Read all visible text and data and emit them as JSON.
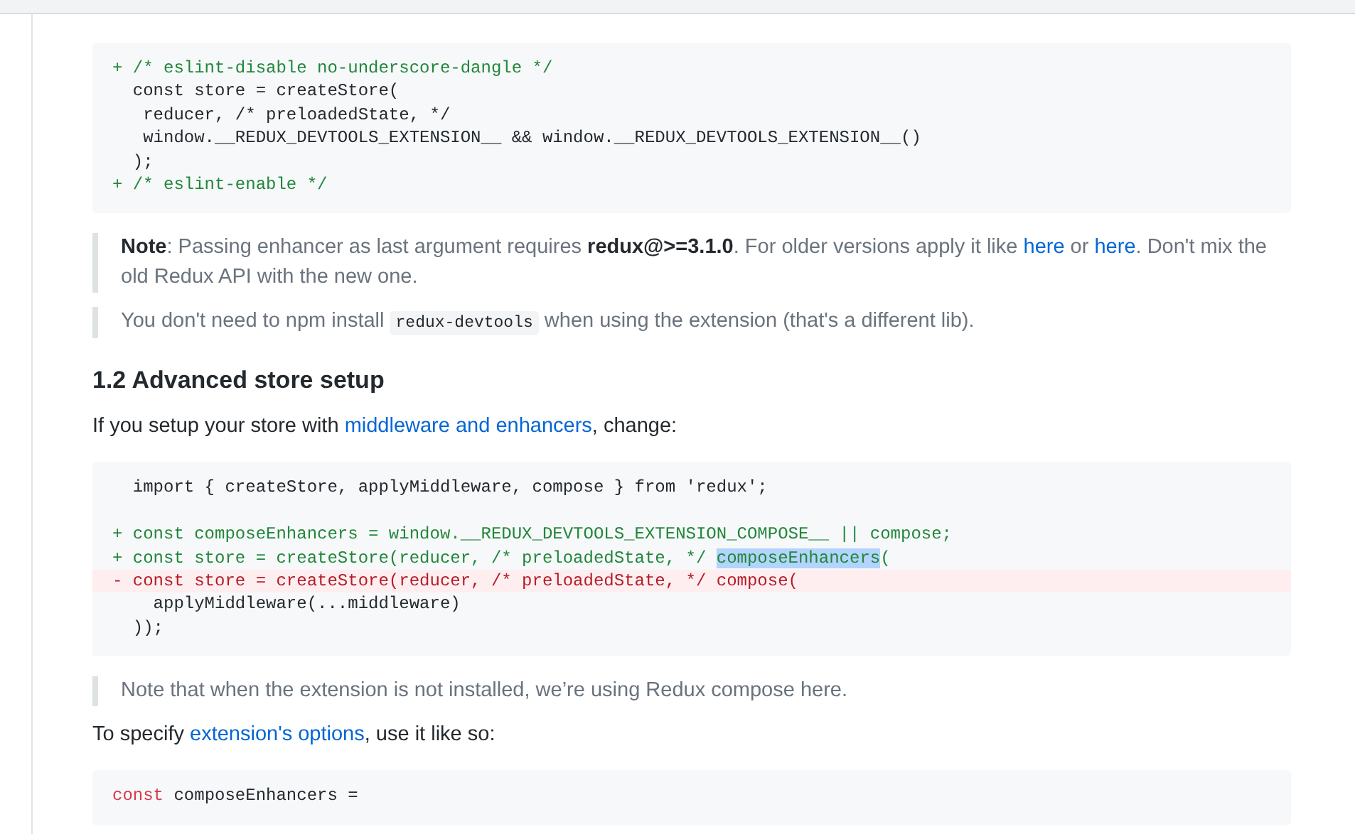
{
  "blocks": [
    {
      "kind": "code",
      "lines": [
        {
          "kind": "add",
          "parts": [
            {
              "text": "+ /* eslint-disable no-underscore-dangle */",
              "selected": false
            }
          ]
        },
        {
          "kind": "plain",
          "parts": [
            {
              "text": "  const store = createStore(",
              "selected": false
            }
          ]
        },
        {
          "kind": "plain",
          "parts": [
            {
              "text": "   reducer, /* preloadedState, */",
              "selected": false
            }
          ]
        },
        {
          "kind": "plain",
          "parts": [
            {
              "text": "   window.__REDUX_DEVTOOLS_EXTENSION__ && window.__REDUX_DEVTOOLS_EXTENSION__()",
              "selected": false
            }
          ]
        },
        {
          "kind": "plain",
          "parts": [
            {
              "text": "  );",
              "selected": false
            }
          ]
        },
        {
          "kind": "add",
          "parts": [
            {
              "text": "+ /* eslint-enable */",
              "selected": false
            }
          ]
        }
      ]
    },
    {
      "kind": "quote",
      "parts": [
        {
          "kind": "bold",
          "text": "Note"
        },
        {
          "kind": "plain",
          "text": ": Passing enhancer as last argument requires "
        },
        {
          "kind": "bold",
          "text": "redux@>=3.1.0"
        },
        {
          "kind": "plain",
          "text": ". For older versions apply it like "
        },
        {
          "kind": "link",
          "text": "here"
        },
        {
          "kind": "plain",
          "text": " or "
        },
        {
          "kind": "link",
          "text": "here"
        },
        {
          "kind": "plain",
          "text": ". Don't mix the old Redux API with the new one."
        }
      ]
    },
    {
      "kind": "quote",
      "parts": [
        {
          "kind": "plain",
          "text": "You don't need to npm install "
        },
        {
          "kind": "code",
          "text": "redux-devtools"
        },
        {
          "kind": "plain",
          "text": " when using the extension (that's a different lib)."
        }
      ]
    },
    {
      "kind": "heading",
      "text": "1.2 Advanced store setup"
    },
    {
      "kind": "paragraph",
      "parts": [
        {
          "kind": "plain",
          "text": "If you setup your store with "
        },
        {
          "kind": "link",
          "text": "middleware and enhancers"
        },
        {
          "kind": "plain",
          "text": ", change:"
        }
      ]
    },
    {
      "kind": "code",
      "lines": [
        {
          "kind": "plain",
          "parts": [
            {
              "text": "  import { createStore, applyMiddleware, compose } from 'redux';",
              "selected": false
            }
          ]
        },
        {
          "kind": "blank"
        },
        {
          "kind": "add",
          "parts": [
            {
              "text": "+ const composeEnhancers = window.__REDUX_DEVTOOLS_EXTENSION_COMPOSE__ || compose;",
              "selected": false
            }
          ]
        },
        {
          "kind": "add",
          "parts": [
            {
              "text": "+ const store = createStore(reducer, /* preloadedState, */ ",
              "selected": false
            },
            {
              "text": "composeEnhancers",
              "selected": true
            },
            {
              "text": "(",
              "selected": false
            }
          ]
        },
        {
          "kind": "del",
          "parts": [
            {
              "text": "- const store = createStore(reducer, /* preloadedState, */ compose(",
              "selected": false
            }
          ]
        },
        {
          "kind": "plain",
          "parts": [
            {
              "text": "    applyMiddleware(...middleware)",
              "selected": false
            }
          ]
        },
        {
          "kind": "plain",
          "parts": [
            {
              "text": "  ));",
              "selected": false
            }
          ]
        }
      ]
    },
    {
      "kind": "quote",
      "parts": [
        {
          "kind": "plain",
          "text": "Note that when the extension is not installed, we’re using Redux compose here."
        }
      ]
    },
    {
      "kind": "paragraph",
      "parts": [
        {
          "kind": "plain",
          "text": "To specify "
        },
        {
          "kind": "link",
          "text": "extension's options"
        },
        {
          "kind": "plain",
          "text": ", use it like so:"
        }
      ]
    },
    {
      "kind": "code",
      "lines": [
        {
          "kind": "keyword",
          "parts": [
            {
              "text": "const",
              "selected": false
            },
            {
              "text": " composeEnhancers =",
              "selected": false
            }
          ]
        }
      ]
    }
  ]
}
